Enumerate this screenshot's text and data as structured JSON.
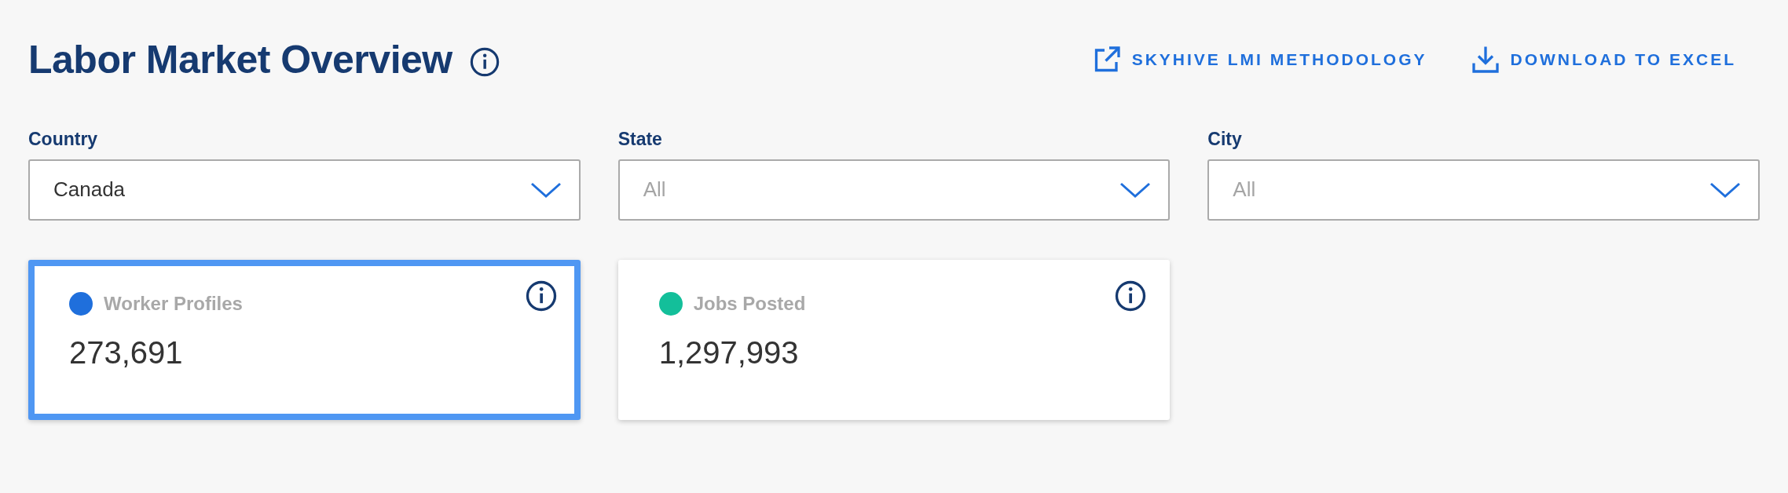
{
  "title": "Labor Market Overview",
  "links": [
    {
      "kind": "external",
      "label": "SKYHIVE LMI METHODOLOGY"
    },
    {
      "kind": "download",
      "label": "DOWNLOAD TO EXCEL"
    }
  ],
  "filters": [
    {
      "label": "Country",
      "value": "Canada"
    },
    {
      "label": "State",
      "placeholder": "All"
    },
    {
      "label": "City",
      "placeholder": "All"
    }
  ],
  "cards": [
    {
      "label": "Worker Profiles",
      "value": "273,691",
      "color": "#1f6fdc",
      "selected": true
    },
    {
      "label": "Jobs Posted",
      "value": "1,297,993",
      "color": "#13bf9a",
      "selected": false
    }
  ]
}
